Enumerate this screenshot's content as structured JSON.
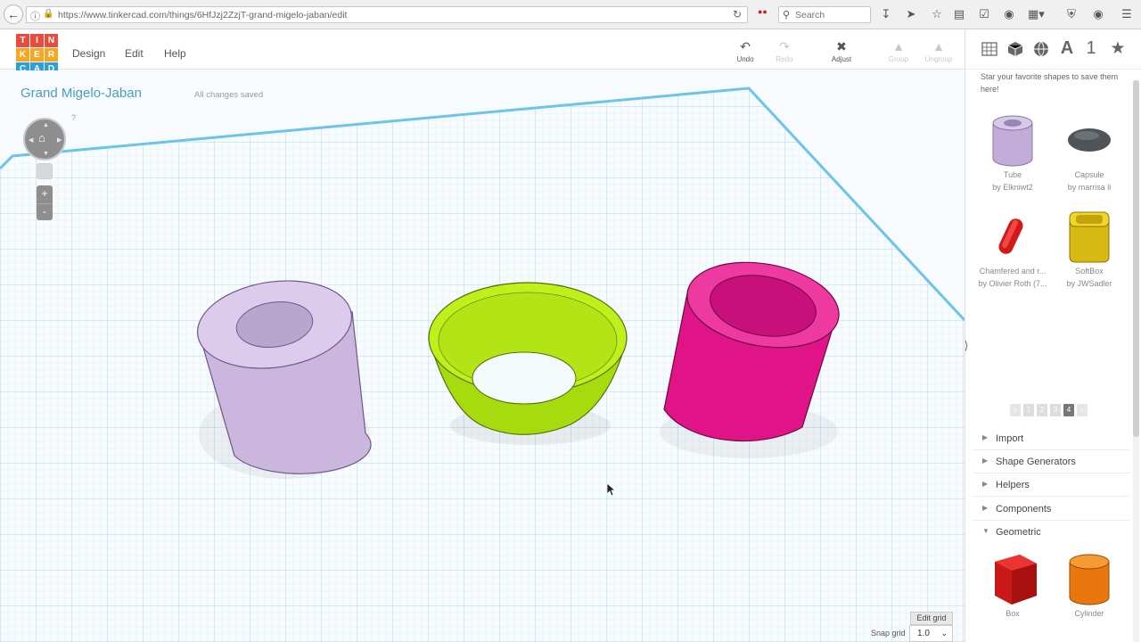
{
  "browser": {
    "url": "https://www.tinkercad.com/things/6HfJzj2ZzjT-grand-migelo-jaban/edit",
    "search_placeholder": "Search"
  },
  "app": {
    "logo_letters": [
      "T",
      "I",
      "N",
      "K",
      "E",
      "R",
      "C",
      "A",
      "D"
    ],
    "logo_colors": [
      "#e84c3d",
      "#e84c3d",
      "#e84c3d",
      "#f5a623",
      "#f5a623",
      "#f5a623",
      "#29a0d8",
      "#29a0d8",
      "#29a0d8"
    ],
    "menu": [
      "Design",
      "Edit",
      "Help"
    ],
    "toolbar": {
      "undo": "Undo",
      "redo": "Redo",
      "adjust": "Adjust",
      "group": "Group",
      "ungroup": "Ungroup"
    }
  },
  "workplane": {
    "title": "Grand Migelo-Jaban",
    "save_status": "All changes saved",
    "help_mark": "?",
    "zoom_in": "+",
    "zoom_out": "-",
    "edit_grid": "Edit grid",
    "snap_grid_label": "Snap grid",
    "snap_grid_value": "1.0"
  },
  "panel": {
    "tabs": [
      "grid-icon",
      "box-icon",
      "sphere-icon",
      "text-icon",
      "number-icon",
      "star-icon"
    ],
    "fav_hint": "Star your favorite shapes to save them here!",
    "shapes": [
      {
        "name": "Tube",
        "author": "by Elkniwt2",
        "color": "#c9b6dc"
      },
      {
        "name": "Capsule",
        "author": "by marrisa li",
        "color": "#555a5e"
      },
      {
        "name": "Chamfered and r...",
        "author": "by Olivier Roth (7...",
        "color": "#e02020"
      },
      {
        "name": "SoftBox",
        "author": "by JWSadler",
        "color": "#e6c81c"
      }
    ],
    "pages": [
      "1",
      "2",
      "3",
      "4"
    ],
    "current_page": "4",
    "sections": [
      "Import",
      "Shape Generators",
      "Helpers",
      "Components",
      "Geometric"
    ],
    "geometric_shapes": [
      {
        "name": "Box",
        "color": "#e0202a"
      },
      {
        "name": "Cylinder",
        "color": "#f0841c"
      }
    ]
  },
  "scene_colors": {
    "tube": "#d8c4e8",
    "cone": "#b8ee1a",
    "pink": "#e8148c",
    "grid": "#a8d8ec",
    "grid_edge": "#6cc4ea"
  }
}
